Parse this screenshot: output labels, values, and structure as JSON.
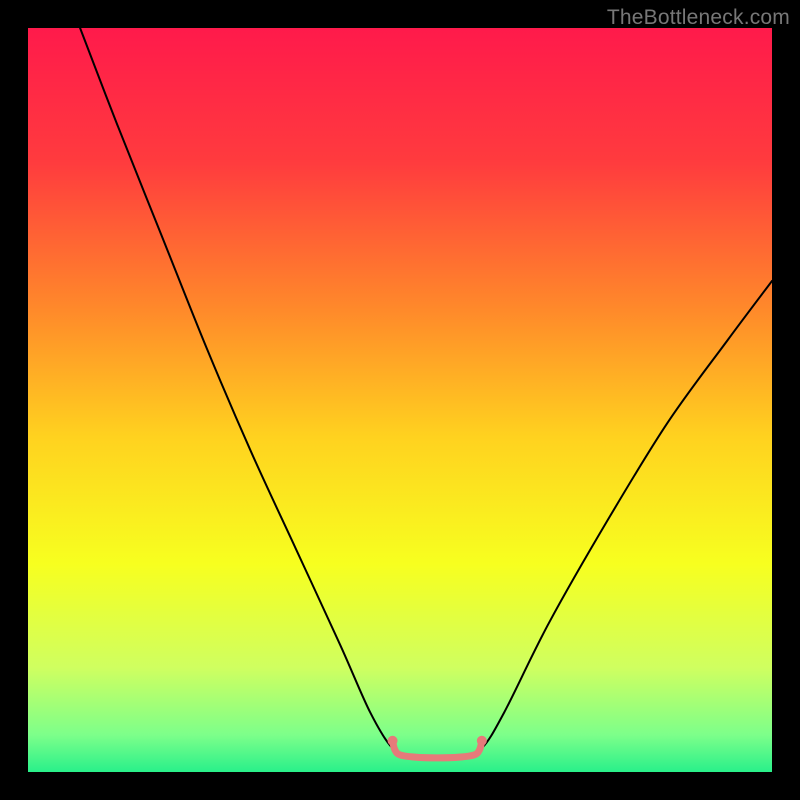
{
  "watermark": "TheBottleneck.com",
  "chart_data": {
    "type": "line",
    "title": "",
    "xlabel": "",
    "ylabel": "",
    "xlim": [
      0,
      100
    ],
    "ylim": [
      0,
      100
    ],
    "gradient_stops": [
      {
        "pos": 0.0,
        "color": "#ff1a4b"
      },
      {
        "pos": 0.18,
        "color": "#ff3b3e"
      },
      {
        "pos": 0.38,
        "color": "#ff8a2a"
      },
      {
        "pos": 0.55,
        "color": "#ffd21f"
      },
      {
        "pos": 0.72,
        "color": "#f7ff1f"
      },
      {
        "pos": 0.86,
        "color": "#cfff60"
      },
      {
        "pos": 0.95,
        "color": "#7dff8a"
      },
      {
        "pos": 1.0,
        "color": "#29f08a"
      }
    ],
    "series": [
      {
        "name": "bottleneck-curve",
        "color": "#000000",
        "width": 2,
        "points": [
          {
            "x": 7.0,
            "y": 100.0
          },
          {
            "x": 12.0,
            "y": 87.0
          },
          {
            "x": 18.0,
            "y": 72.0
          },
          {
            "x": 24.0,
            "y": 57.0
          },
          {
            "x": 30.0,
            "y": 43.0
          },
          {
            "x": 36.0,
            "y": 30.0
          },
          {
            "x": 42.0,
            "y": 17.0
          },
          {
            "x": 46.0,
            "y": 8.0
          },
          {
            "x": 49.0,
            "y": 3.2
          },
          {
            "x": 51.5,
            "y": 2.3
          },
          {
            "x": 55.0,
            "y": 2.2
          },
          {
            "x": 58.5,
            "y": 2.3
          },
          {
            "x": 61.0,
            "y": 3.2
          },
          {
            "x": 64.0,
            "y": 8.0
          },
          {
            "x": 70.0,
            "y": 20.0
          },
          {
            "x": 78.0,
            "y": 34.0
          },
          {
            "x": 86.0,
            "y": 47.0
          },
          {
            "x": 94.0,
            "y": 58.0
          },
          {
            "x": 100.0,
            "y": 66.0
          }
        ]
      },
      {
        "name": "optimal-zone",
        "color": "#e67a7a",
        "width": 7,
        "points": [
          {
            "x": 49.0,
            "y": 4.2
          },
          {
            "x": 49.3,
            "y": 3.0
          },
          {
            "x": 50.0,
            "y": 2.3
          },
          {
            "x": 52.0,
            "y": 2.0
          },
          {
            "x": 55.0,
            "y": 1.9
          },
          {
            "x": 58.0,
            "y": 2.0
          },
          {
            "x": 60.0,
            "y": 2.3
          },
          {
            "x": 60.7,
            "y": 3.0
          },
          {
            "x": 61.0,
            "y": 4.2
          }
        ]
      }
    ],
    "markers": [
      {
        "name": "optimal-left-endpoint",
        "x": 49.0,
        "y": 4.2,
        "r": 5,
        "color": "#e67a7a"
      },
      {
        "name": "optimal-right-endpoint",
        "x": 61.0,
        "y": 4.2,
        "r": 5,
        "color": "#e67a7a"
      }
    ]
  }
}
